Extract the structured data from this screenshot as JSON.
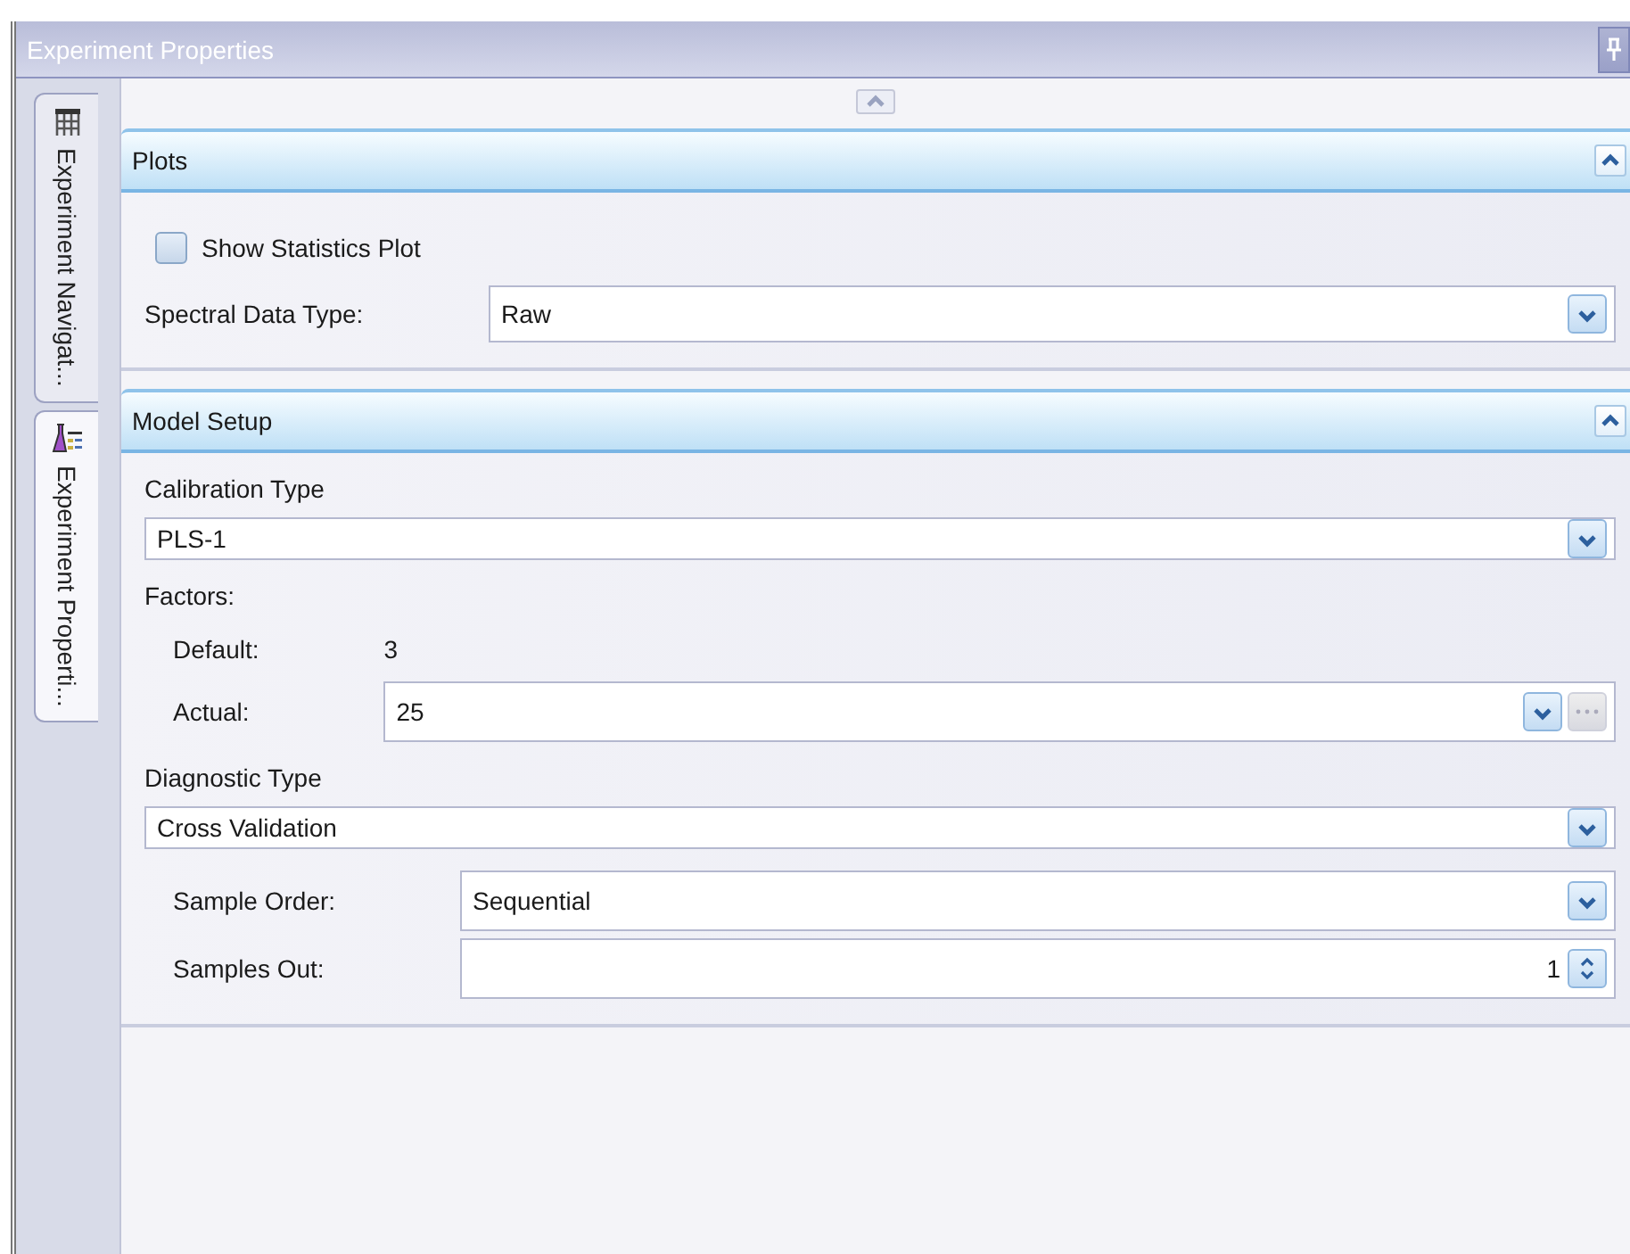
{
  "window": {
    "title": "Experiment Properties"
  },
  "side_tabs": [
    {
      "label": "Experiment Navigat...",
      "selected": false
    },
    {
      "label": "Experiment Properti...",
      "selected": true
    }
  ],
  "sections": [
    {
      "title": "Plots",
      "expanded": true,
      "fields": [
        {
          "kind": "checkbox",
          "label": "Show Statistics Plot",
          "checked": false
        },
        {
          "kind": "dropdown",
          "label": "Spectral Data Type:",
          "value": "Raw"
        }
      ]
    },
    {
      "title": "Model Setup",
      "expanded": true,
      "fields": [
        {
          "kind": "heading",
          "label": "Calibration Type"
        },
        {
          "kind": "dropdown",
          "value": "PLS-1"
        },
        {
          "kind": "heading",
          "label": "Factors:"
        },
        {
          "kind": "group",
          "children": [
            {
              "kind": "readout",
              "label": "Default:",
              "value": "3"
            },
            {
              "kind": "dropdown_ellipsis",
              "label": "Actual:",
              "value": "25"
            }
          ]
        },
        {
          "kind": "heading",
          "label": "Diagnostic Type"
        },
        {
          "kind": "dropdown",
          "value": "Cross Validation"
        },
        {
          "kind": "group",
          "children": [
            {
              "kind": "dropdown",
              "label": "Sample Order:",
              "value": "Sequential"
            },
            {
              "kind": "spinner",
              "label": "Samples Out:",
              "value": "1"
            }
          ]
        }
      ]
    }
  ]
}
